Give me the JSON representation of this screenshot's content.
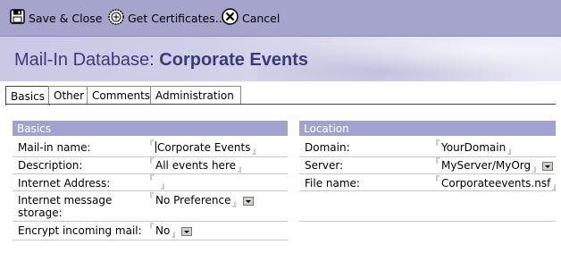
{
  "toolbar": {
    "save_label": "Save & Close",
    "certs_label": "Get Certificates...",
    "cancel_label": "Cancel",
    "save_icon": "floppy-disk-icon",
    "certs_icon": "certificate-icon",
    "cancel_icon": "cancel-x-icon"
  },
  "header": {
    "prefix": "Mail-In Database: ",
    "name": "Corporate Events",
    "title_color": "#3b3b7a"
  },
  "tabs": [
    {
      "label": "Basics",
      "active": true
    },
    {
      "label": "Other",
      "active": false
    },
    {
      "label": "Comments",
      "active": false
    },
    {
      "label": "Administration",
      "active": false
    }
  ],
  "basics": {
    "heading": "Basics",
    "heading_color": "#a2a2cf",
    "fields": [
      {
        "label": "Mail-in name:",
        "value": "Corporate Events",
        "dropdown": false
      },
      {
        "label": "Description:",
        "value": "All events here",
        "dropdown": false
      },
      {
        "label": "Internet Address:",
        "value": "",
        "dropdown": false
      },
      {
        "label": "Internet message storage:",
        "value": "No Preference",
        "dropdown": true
      },
      {
        "label": "Encrypt incoming mail:",
        "value": "No",
        "dropdown": true
      }
    ]
  },
  "location": {
    "heading": "Location",
    "fields": [
      {
        "label": "Domain:",
        "value": "YourDomain",
        "dropdown": false
      },
      {
        "label": "Server:",
        "value": "MyServer/MyOrg",
        "dropdown": true
      },
      {
        "label": "File name:",
        "value": "Corporateevents.nsf",
        "dropdown": false
      }
    ]
  },
  "field_bracket_open": "『",
  "field_bracket_close": "』"
}
